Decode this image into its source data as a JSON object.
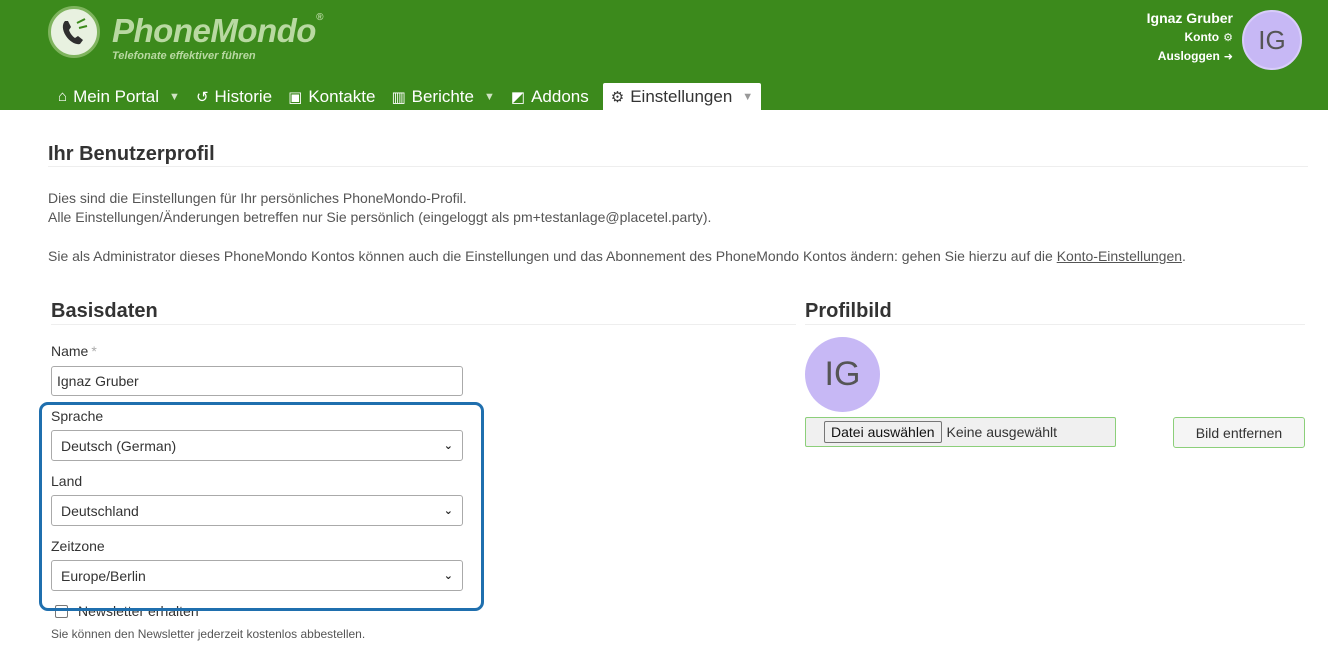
{
  "brand": {
    "name": "PhoneMondo",
    "registered": "®",
    "tagline": "Telefonate effektiver führen",
    "color": "#3c8a1c"
  },
  "user": {
    "name": "Ignaz Gruber",
    "initials": "IG",
    "account_link": "Konto",
    "logout_link": "Ausloggen",
    "avatar_color": "#c7b8f5"
  },
  "nav": {
    "items": [
      {
        "label": "Mein Portal",
        "icon": "home-icon",
        "has_dropdown": true
      },
      {
        "label": "Historie",
        "icon": "history-icon",
        "has_dropdown": false
      },
      {
        "label": "Kontakte",
        "icon": "contacts-icon",
        "has_dropdown": false
      },
      {
        "label": "Berichte",
        "icon": "chart-icon",
        "has_dropdown": true
      },
      {
        "label": "Addons",
        "icon": "puzzle-icon",
        "has_dropdown": false
      },
      {
        "label": "Einstellungen",
        "icon": "gears-icon",
        "has_dropdown": true,
        "active": true
      }
    ]
  },
  "page": {
    "title": "Ihr Benutzerprofil",
    "intro_line1": "Dies sind die Einstellungen für Ihr persönliches PhoneMondo-Profil.",
    "intro_line2": "Alle Einstellungen/Änderungen betreffen nur Sie persönlich (eingeloggt als pm+testanlage@placetel.party).",
    "admin_note_prefix": "Sie als Administrator dieses PhoneMondo Kontos können auch die Einstellungen und das Abonnement des PhoneMondo Kontos ändern: gehen Sie hierzu auf die ",
    "admin_note_link": "Konto-Einstellungen",
    "admin_note_suffix": "."
  },
  "basisdaten": {
    "title": "Basisdaten",
    "name_label": "Name",
    "required_marker": "*",
    "name_value": "Ignaz Gruber",
    "language_label": "Sprache",
    "language_value": "Deutsch (German)",
    "country_label": "Land",
    "country_value": "Deutschland",
    "timezone_label": "Zeitzone",
    "timezone_value": "Europe/Berlin",
    "newsletter_label": "Newsletter erhalten",
    "newsletter_checked": false,
    "newsletter_hint": "Sie können den Newsletter jederzeit kostenlos abbestellen.",
    "highlight_color": "#1f6fae"
  },
  "profilbild": {
    "title": "Profilbild",
    "initials": "IG",
    "file_button": "Datei auswählen",
    "file_status": "Keine ausgewählt",
    "remove_button": "Bild entfernen"
  }
}
